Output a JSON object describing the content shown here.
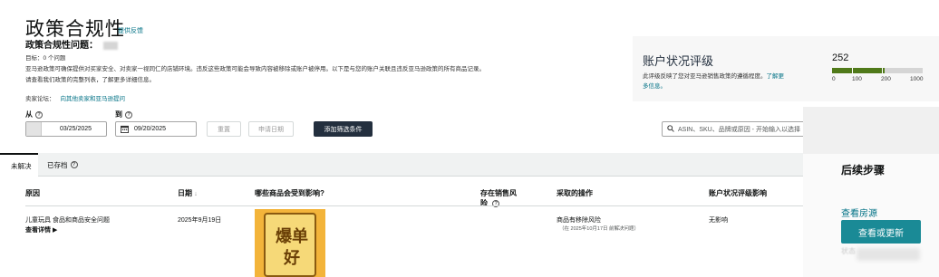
{
  "header": {
    "title": "政策合规性",
    "feedback_link": "提供反馈",
    "issue_title": "政策合规性问题：",
    "target": "目标：0 个问题",
    "description": "亚马逊政策可确保提供对买家安全、对卖家一视同仁的店铺环境。违反这些政策可能会导致内容被移除或账户被停用。以下是与您的账户关联且违反亚马逊政策的所有商品记录。请查看我们政策的完整列表，了解更多详细信息。",
    "forum_label": "卖家论坛：",
    "forum_link": "向其他卖家和亚马逊提问"
  },
  "filters": {
    "from_label": "从",
    "to_label": "到",
    "from_date": "03/25/2025",
    "to_date": "09/20/2025",
    "reset_label": "重置",
    "apply_date_label": "申请日期",
    "add_filter_label": "添加筛选条件",
    "search_placeholder": "ASIN、SKU、品牌或原因 - 开始输入以选择"
  },
  "account_health": {
    "title": "账户状况评级",
    "description_prefix": "此评级反映了您对亚马逊销售政策的遵循程度。",
    "learn_more": "了解更多信息。",
    "score": "252",
    "score_value": 252,
    "max_value": 1000,
    "ticks": [
      "0",
      "100",
      "200",
      "1000"
    ],
    "colors": {
      "good": "#507a1a",
      "track": "#d5d5d5"
    }
  },
  "tabs": {
    "active": "未解决",
    "archived": "已存档"
  },
  "table": {
    "headers": {
      "reason": "原因",
      "date": "日期",
      "affected": "哪些商品会受到影响?",
      "sales_risk": "存在销售风险",
      "action": "采取的操作",
      "impact": "账户状况评级影响"
    },
    "sort_arrow": "↓",
    "rows": [
      {
        "reason": "儿童玩具 食品和商品安全问题",
        "details_link": "查看详情 ▶",
        "date": "2025年9月19日",
        "image_text_top": "爆单",
        "image_text_bottom": "好",
        "action": "商品有移除风险",
        "action_note": "（在 2025年10月17日 前解决问题）",
        "impact": "无影响"
      }
    ]
  },
  "next_steps": {
    "title": "后续步骤",
    "view_source": "查看房源",
    "view_update": "查看或更新",
    "status_label": "状态"
  }
}
